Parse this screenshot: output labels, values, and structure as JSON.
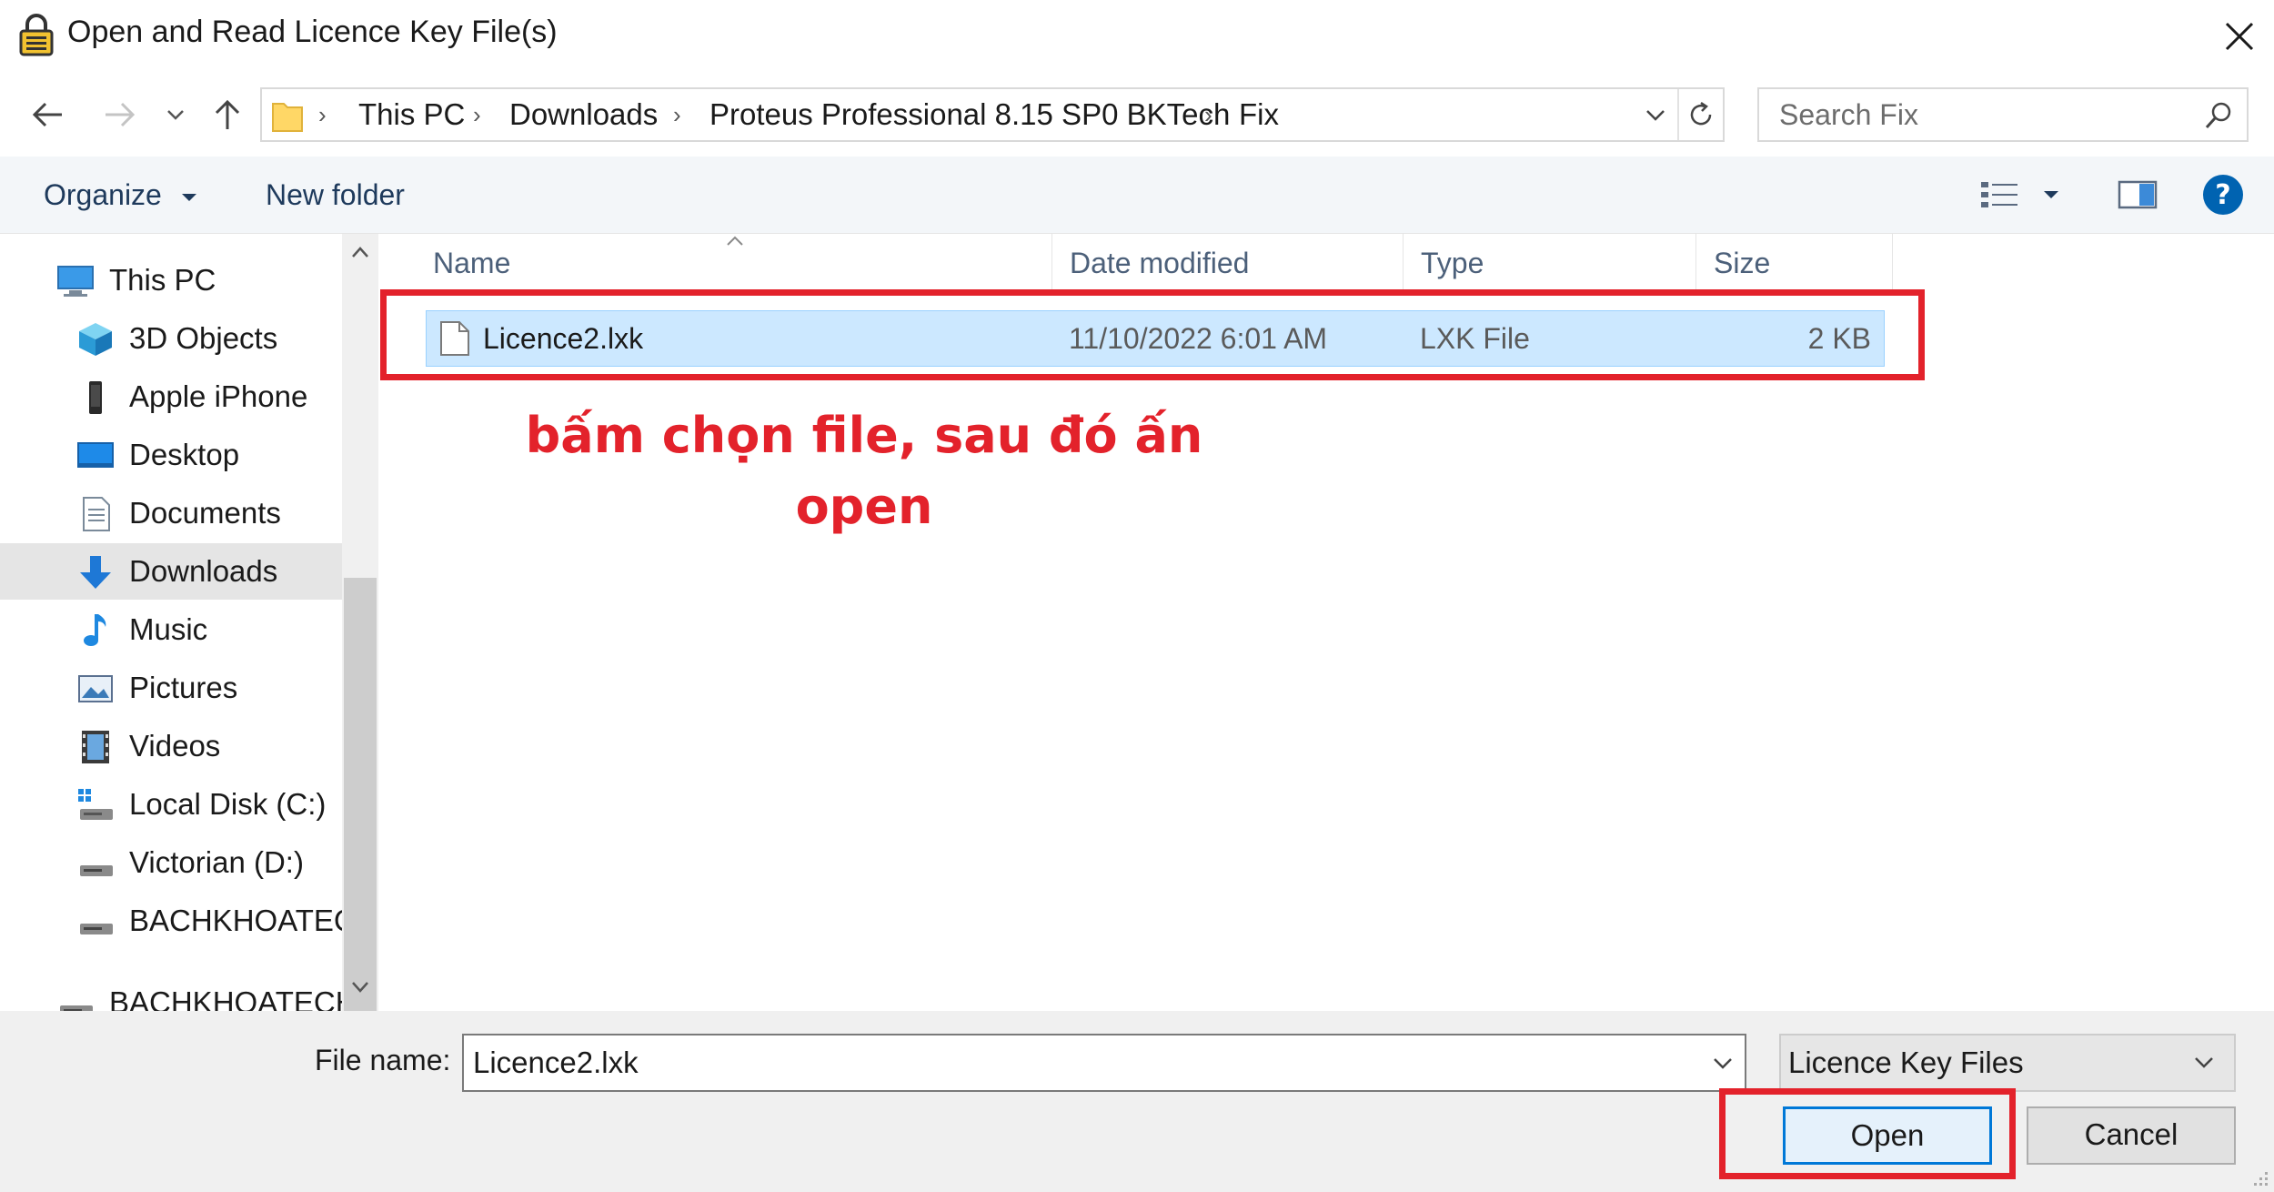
{
  "window": {
    "title": "Open and Read Licence Key File(s)"
  },
  "address": {
    "crumbs": [
      "This PC",
      "Downloads",
      "Proteus Professional 8.15 SP0 BKTech",
      "Fix"
    ]
  },
  "search": {
    "placeholder": "Search Fix"
  },
  "toolbar": {
    "organize_label": "Organize",
    "new_folder_label": "New folder"
  },
  "nav_pane": {
    "items": [
      {
        "label": "This PC",
        "icon": "computer-icon"
      },
      {
        "label": "3D Objects",
        "icon": "cube-icon"
      },
      {
        "label": "Apple iPhone",
        "icon": "phone-icon"
      },
      {
        "label": "Desktop",
        "icon": "desktop-icon"
      },
      {
        "label": "Documents",
        "icon": "document-icon"
      },
      {
        "label": "Downloads",
        "icon": "download-arrow-icon"
      },
      {
        "label": "Music",
        "icon": "music-note-icon"
      },
      {
        "label": "Pictures",
        "icon": "picture-icon"
      },
      {
        "label": "Videos",
        "icon": "film-icon"
      },
      {
        "label": "Local Disk (C:)",
        "icon": "windows-drive-icon"
      },
      {
        "label": "Victorian (D:)",
        "icon": "drive-icon"
      },
      {
        "label": "BACHKHOATECI",
        "icon": "drive-icon"
      },
      {
        "label": "BACHKHOATECH",
        "icon": "drive-icon"
      }
    ],
    "selected": "Downloads"
  },
  "file_list": {
    "columns": [
      "Name",
      "Date modified",
      "Type",
      "Size"
    ],
    "rows": [
      {
        "name": "Licence2.lxk",
        "date_modified": "11/10/2022 6:01 AM",
        "type": "LXK File",
        "size": "2 KB"
      }
    ]
  },
  "annotation": {
    "line1": "bấm chọn file, sau đó ấn",
    "line2": "open",
    "color": "#e3222b"
  },
  "bottom": {
    "file_name_label": "File name:",
    "file_name_value": "Licence2.lxk",
    "file_type_value": "Licence Key Files",
    "open_label": "Open",
    "cancel_label": "Cancel"
  },
  "colors": {
    "selection": "#cce8ff",
    "accent": "#0078d7",
    "help": "#0063b1"
  }
}
